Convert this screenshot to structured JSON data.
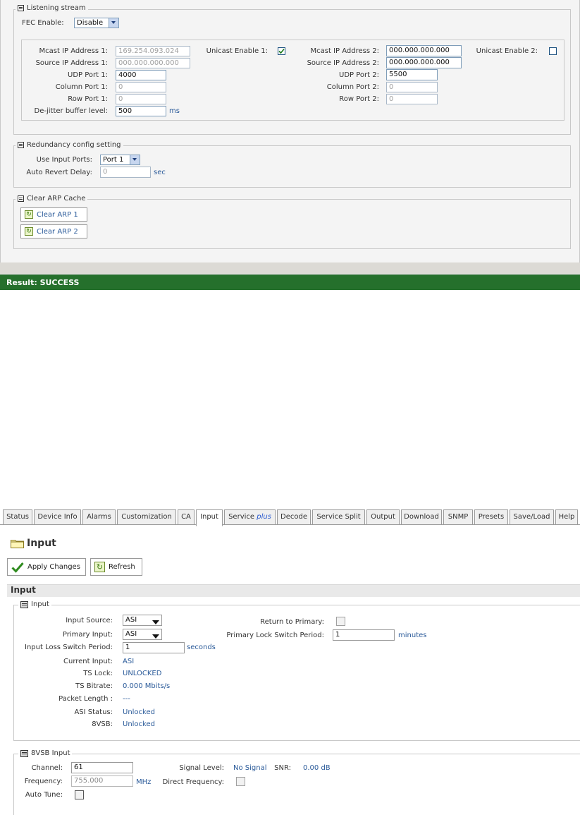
{
  "listening": {
    "legend": "Listening stream",
    "fec_label": "FEC Enable:",
    "fec_value": "Disable",
    "mcast1_label": "Mcast IP Address 1:",
    "mcast1_value": "169.254.093.024",
    "source1_label": "Source IP Address 1:",
    "source1_value": "000.000.000.000",
    "udp1_label": "UDP Port 1:",
    "udp1_value": "4000",
    "col1_label": "Column Port 1:",
    "col1_value": "0",
    "row1_label": "Row Port 1:",
    "row1_value": "0",
    "dejitter_label": "De-jitter buffer level:",
    "dejitter_value": "500",
    "dejitter_unit": "ms",
    "unicast1_label": "Unicast Enable 1:",
    "unicast1_checked": true,
    "mcast2_label": "Mcast IP Address 2:",
    "mcast2_value": "000.000.000.000",
    "source2_label": "Source IP Address 2:",
    "source2_value": "000.000.000.000",
    "udp2_label": "UDP Port 2:",
    "udp2_value": "5500",
    "col2_label": "Column Port 2:",
    "col2_value": "0",
    "row2_label": "Row Port 2:",
    "row2_value": "0",
    "unicast2_label": "Unicast Enable 2:"
  },
  "redundancy": {
    "legend": "Redundancy config setting",
    "ports_label": "Use Input Ports:",
    "ports_value": "Port 1",
    "delay_label": "Auto Revert Delay:",
    "delay_value": "0",
    "delay_unit": "sec"
  },
  "arp": {
    "legend": "Clear ARP Cache",
    "btn1": "Clear ARP 1",
    "btn2": "Clear ARP 2"
  },
  "result": {
    "text": "Result: SUCCESS",
    "color": "#25702c"
  },
  "tabs": [
    {
      "label": "Status"
    },
    {
      "label": "Device Info"
    },
    {
      "label": "Alarms"
    },
    {
      "label": "Customization"
    },
    {
      "label": "CA"
    },
    {
      "label": "Input"
    },
    {
      "label": "Service",
      "suffix": "plus"
    },
    {
      "label": "Decode"
    },
    {
      "label": "Service Split"
    },
    {
      "label": "Output"
    },
    {
      "label": "Download"
    },
    {
      "label": "SNMP"
    },
    {
      "label": "Presets"
    },
    {
      "label": "Save/Load"
    },
    {
      "label": "Help"
    }
  ],
  "page": {
    "title": "Input",
    "apply_label": "Apply Changes",
    "refresh_label": "Refresh",
    "section_title": "Input"
  },
  "input": {
    "legend": "Input",
    "source_label": "Input Source:",
    "source_value": "ASI",
    "primary_label": "Primary Input:",
    "primary_value": "ASI",
    "loss_label": "Input Loss Switch Period:",
    "loss_value": "1",
    "loss_unit": "seconds",
    "current_label": "Current Input:",
    "current_value": "ASI",
    "tslock_label": "TS Lock:",
    "tslock_value": "UNLOCKED",
    "bitrate_label": "TS Bitrate:",
    "bitrate_value": "0.000 Mbits/s",
    "packet_label": "Packet Length :",
    "packet_value": "---",
    "asi_label": "ASI Status:",
    "asi_value": "Unlocked",
    "vsb_label": "8VSB:",
    "vsb_value": "Unlocked",
    "return_label": "Return to Primary:",
    "lock_label": "Primary Lock Switch Period:",
    "lock_value": "1",
    "lock_unit": "minutes"
  },
  "vsb": {
    "legend": "8VSB Input",
    "channel_label": "Channel:",
    "channel_value": "61",
    "freq_label": "Frequency:",
    "freq_value": "755.000",
    "freq_unit": "MHz",
    "autotune_label": "Auto Tune:",
    "signal_label": "Signal Level:",
    "signal_value": "No Signal",
    "snr_label": "SNR:",
    "snr_value": "0.00 dB",
    "direct_label": "Direct Frequency:"
  }
}
